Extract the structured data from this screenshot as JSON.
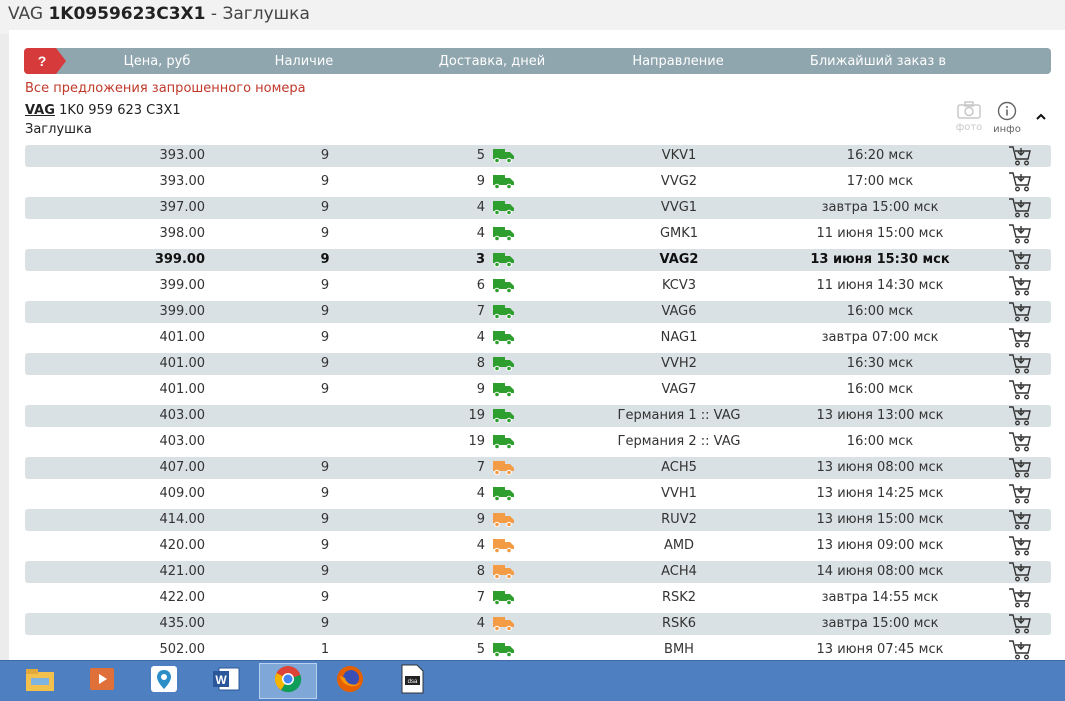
{
  "title": {
    "brand": "VAG",
    "number": "1K0959623C3X1",
    "sep": "-",
    "name": "Заглушка"
  },
  "header": {
    "badge": "?",
    "columns": [
      "Цена, руб",
      "Наличие",
      "Доставка, дней",
      "Направление",
      "Ближайший заказ в"
    ]
  },
  "all_offers_note": "Все предложения запрошенного номера",
  "product": {
    "brand": "VAG",
    "number": "1K0 959 623 C3X1",
    "description": "Заглушка"
  },
  "tools": {
    "photo_label": "фото",
    "info_label": "инфо"
  },
  "colors": {
    "header": "#8fa6ae",
    "row_alt": "#d9e1e4",
    "truck_green": "#2e9e2e",
    "truck_orange": "#f39c45",
    "badge_red": "#d63a3a"
  },
  "offers": [
    {
      "price": "393.00",
      "stock": "9",
      "days": "5",
      "truck": "green",
      "direction": "VKV1",
      "nearest": "16:20 мск"
    },
    {
      "price": "393.00",
      "stock": "9",
      "days": "9",
      "truck": "green",
      "direction": "VVG2",
      "nearest": "17:00 мск"
    },
    {
      "price": "397.00",
      "stock": "9",
      "days": "4",
      "truck": "green",
      "direction": "VVG1",
      "nearest": "завтра 15:00 мск"
    },
    {
      "price": "398.00",
      "stock": "9",
      "days": "4",
      "truck": "green",
      "direction": "GMK1",
      "nearest": "11 июня 15:00 мск"
    },
    {
      "price": "399.00",
      "stock": "9",
      "days": "3",
      "truck": "green",
      "direction": "VAG2",
      "nearest": "13 июня 15:30 мск",
      "bold": true
    },
    {
      "price": "399.00",
      "stock": "9",
      "days": "6",
      "truck": "green",
      "direction": "KCV3",
      "nearest": "11 июня 14:30 мск"
    },
    {
      "price": "399.00",
      "stock": "9",
      "days": "7",
      "truck": "green",
      "direction": "VAG6",
      "nearest": "16:00 мск"
    },
    {
      "price": "401.00",
      "stock": "9",
      "days": "4",
      "truck": "green",
      "direction": "NAG1",
      "nearest": "завтра 07:00 мск"
    },
    {
      "price": "401.00",
      "stock": "9",
      "days": "8",
      "truck": "green",
      "direction": "VVH2",
      "nearest": "16:30 мск"
    },
    {
      "price": "401.00",
      "stock": "9",
      "days": "9",
      "truck": "green",
      "direction": "VAG7",
      "nearest": "16:00 мск"
    },
    {
      "price": "403.00",
      "stock": "",
      "days": "19",
      "truck": "green",
      "direction": "Германия 1 :: VAG",
      "nearest": "13 июня 13:00 мск"
    },
    {
      "price": "403.00",
      "stock": "",
      "days": "19",
      "truck": "green",
      "direction": "Германия 2 :: VAG",
      "nearest": "16:00 мск"
    },
    {
      "price": "407.00",
      "stock": "9",
      "days": "7",
      "truck": "orange",
      "direction": "ACH5",
      "nearest": "13 июня 08:00 мск"
    },
    {
      "price": "409.00",
      "stock": "9",
      "days": "4",
      "truck": "green",
      "direction": "VVH1",
      "nearest": "13 июня 14:25 мск"
    },
    {
      "price": "414.00",
      "stock": "9",
      "days": "9",
      "truck": "orange",
      "direction": "RUV2",
      "nearest": "13 июня 15:00 мск"
    },
    {
      "price": "420.00",
      "stock": "9",
      "days": "4",
      "truck": "orange",
      "direction": "AMD",
      "nearest": "13 июня 09:00 мск"
    },
    {
      "price": "421.00",
      "stock": "9",
      "days": "8",
      "truck": "orange",
      "direction": "ACH4",
      "nearest": "14 июня 08:00 мск"
    },
    {
      "price": "422.00",
      "stock": "9",
      "days": "7",
      "truck": "green",
      "direction": "RSK2",
      "nearest": "завтра 14:55 мск"
    },
    {
      "price": "435.00",
      "stock": "9",
      "days": "4",
      "truck": "orange",
      "direction": "RSK6",
      "nearest": "завтра 15:00 мск"
    },
    {
      "price": "502.00",
      "stock": "1",
      "days": "5",
      "truck": "green",
      "direction": "BMH",
      "nearest": "13 июня 07:45 мск"
    }
  ],
  "taskbar": {
    "icons": [
      "file-explorer-icon",
      "media-player-icon",
      "maps-icon",
      "word-icon",
      "chrome-icon",
      "firefox-icon",
      "document-app-icon"
    ],
    "active": "chrome-icon"
  }
}
